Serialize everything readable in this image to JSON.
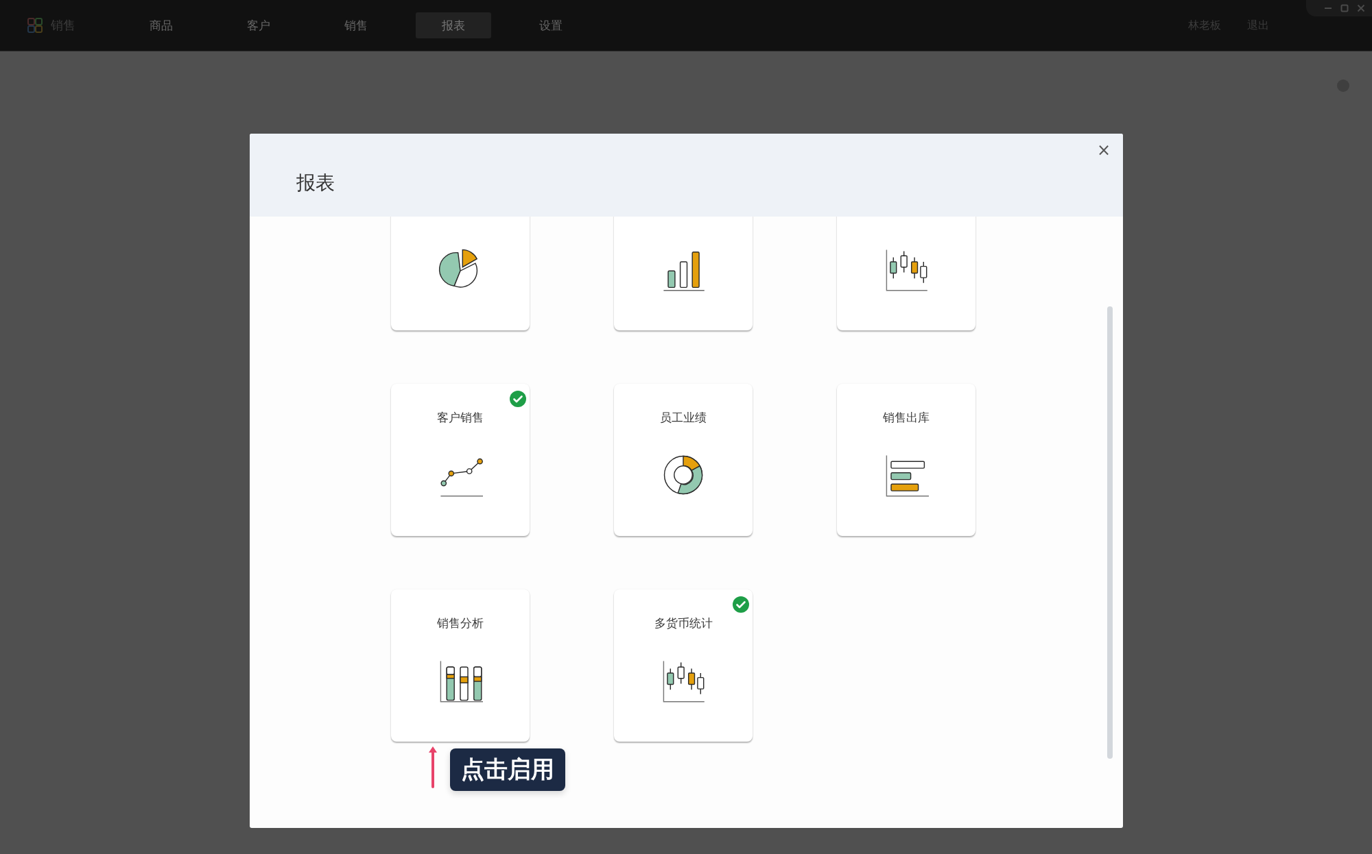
{
  "top_bar": {
    "app_name": "销售",
    "nav": [
      {
        "label": "商品",
        "selected": false
      },
      {
        "label": "客户",
        "selected": false
      },
      {
        "label": "销售",
        "selected": false
      },
      {
        "label": "报表",
        "selected": true
      },
      {
        "label": "设置",
        "selected": false
      }
    ],
    "user": "林老板",
    "logout": "退出"
  },
  "dialog": {
    "title": "报表",
    "close": "×",
    "cards": [
      {
        "kind": "pie"
      },
      {
        "kind": "bar"
      },
      {
        "kind": "candlestick"
      },
      {
        "title": "客户销售",
        "kind": "line",
        "enabled": true
      },
      {
        "title": "员工业绩",
        "kind": "donut",
        "enabled": false
      },
      {
        "title": "销售出库",
        "kind": "hbar",
        "enabled": false
      },
      {
        "title": "销售分析",
        "kind": "stacked",
        "enabled": false,
        "hint": "点击启用"
      },
      {
        "title": "多货币统计",
        "kind": "candlestick",
        "enabled": true
      }
    ]
  }
}
